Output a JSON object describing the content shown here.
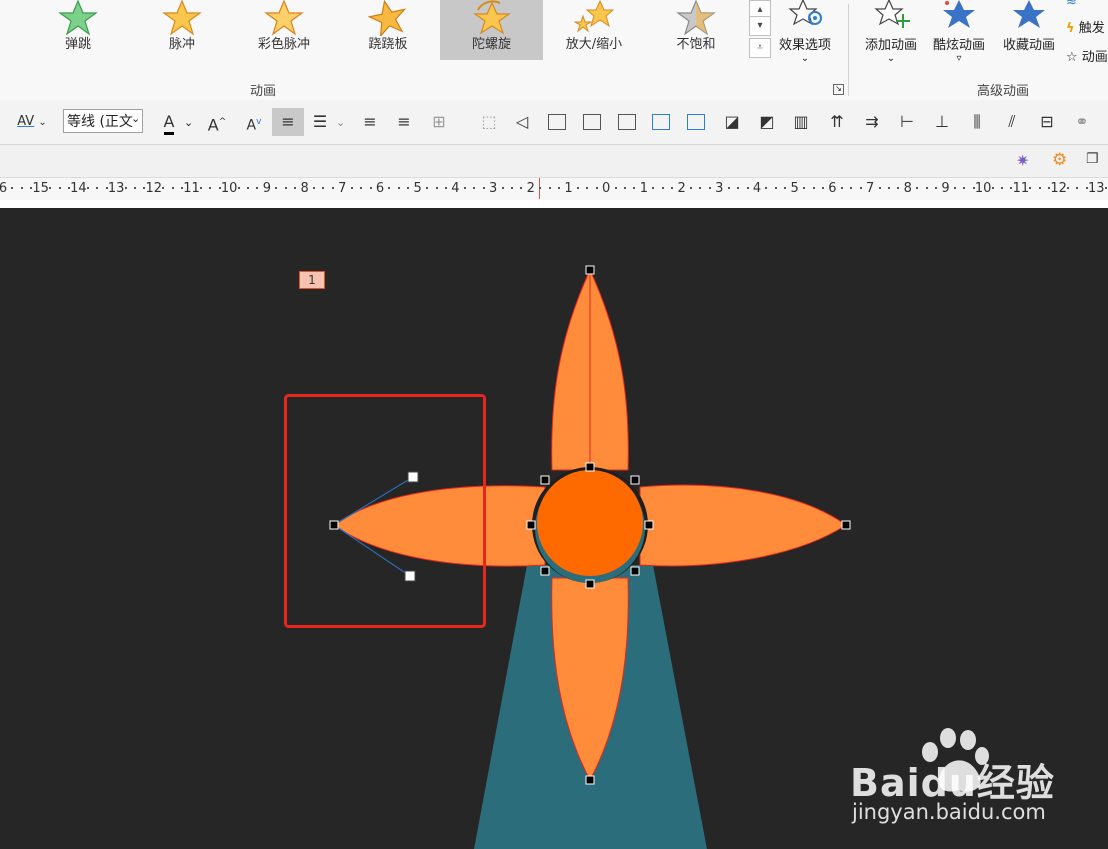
{
  "ribbon": {
    "animations": [
      {
        "label": "弹跳",
        "icon": "green-star-icon"
      },
      {
        "label": "脉冲",
        "icon": "gold-star-icon"
      },
      {
        "label": "彩色脉冲",
        "icon": "gold-star-icon"
      },
      {
        "label": "跷跷板",
        "icon": "gold-star-icon"
      },
      {
        "label": "陀螺旋",
        "icon": "spinning-star-icon",
        "selected": true
      },
      {
        "label": "放大/缩小",
        "icon": "grow-star-icon"
      },
      {
        "label": "不饱和",
        "icon": "gray-star-icon"
      }
    ],
    "effect_options": "效果选项",
    "animation_group": "动画",
    "advanced_group": "高级动画",
    "add_animation": "添加动画",
    "cool_animation": "酷炫动画",
    "collect_animation": "收藏动画",
    "trigger": "触发",
    "animation_pane": "动画",
    "colors": {
      "star_gold": "#f6a623",
      "star_green": "#5cbf6a",
      "star_blue": "#3a73c6"
    }
  },
  "format_bar": {
    "char_spacing": "AV",
    "font_name": "等线 (正文",
    "font_color": "A",
    "grow_font": "A",
    "shrink_font": "A"
  },
  "ruler": {
    "ticks": [
      "6",
      "15",
      "14",
      "13",
      "12",
      "11",
      "10",
      "9",
      "8",
      "7",
      "6",
      "5",
      "4",
      "3",
      "2",
      "1",
      "0",
      "1",
      "2",
      "3",
      "4",
      "5",
      "6",
      "7",
      "8",
      "9",
      "10",
      "11",
      "12",
      "13"
    ]
  },
  "slide": {
    "background": "#262626",
    "animation_order_tag": "1",
    "colors": {
      "petal": "#ff8c3a",
      "center": "#ff6a00",
      "beam": "#2b6d7a",
      "highlight_box": "#e8261c"
    }
  },
  "watermark": {
    "brand": "Baidu经验",
    "url": "jingyan.baidu.com"
  }
}
